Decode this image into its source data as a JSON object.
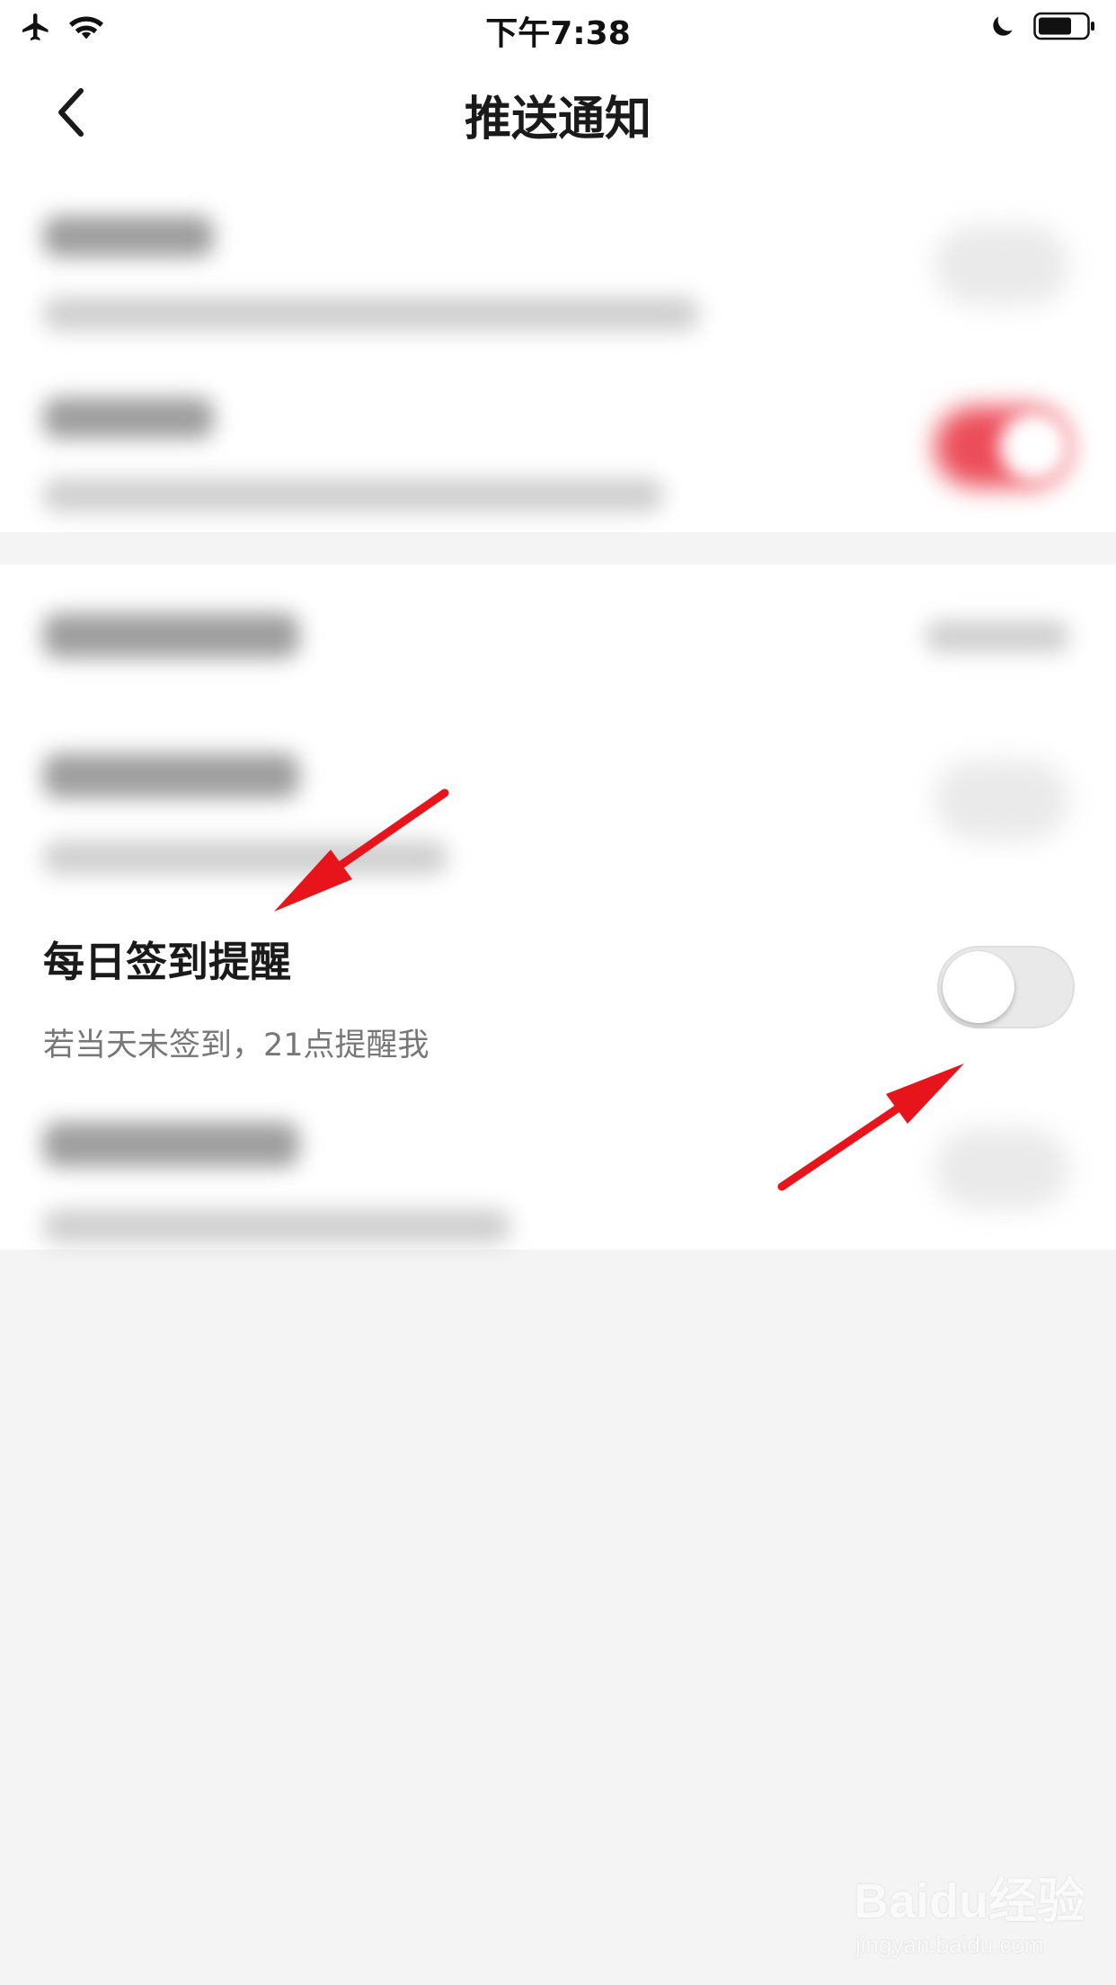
{
  "status_bar": {
    "time": "下午7:38",
    "icons": [
      "airplane-icon",
      "wifi-icon",
      "moon-icon",
      "battery-icon"
    ]
  },
  "nav": {
    "title": "推送通知",
    "back_icon": "chevron-left-icon"
  },
  "settings": {
    "daily_checkin": {
      "title": "每日签到提醒",
      "subtitle": "若当天未签到，21点提醒我",
      "toggle_on": false
    }
  },
  "watermark": {
    "logo": "Baidu经验",
    "url": "jingyan.baidu.com"
  },
  "colors": {
    "accent_red": "#ec4d5a",
    "arrow_red": "#e8141b",
    "background": "#f4f4f4"
  }
}
